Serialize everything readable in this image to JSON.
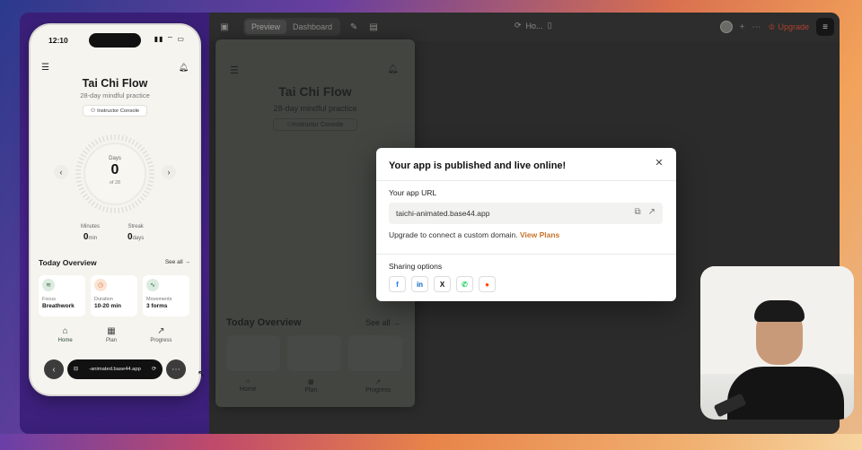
{
  "toolbar": {
    "preview_tab": "Preview",
    "dashboard_tab": "Dashboard",
    "center_label": "Ho...",
    "upgrade_label": "Upgrade"
  },
  "phone": {
    "time": "12:10",
    "app_title": "Tai Chi Flow",
    "app_subtitle": "28-day mindful practice",
    "instructor_console": "Instructor Console",
    "days_label": "Days",
    "days_value": "0",
    "days_of": "of 28",
    "stats": [
      {
        "label": "Minutes",
        "value": "0",
        "unit": "min"
      },
      {
        "label": "Streak",
        "value": "0",
        "unit": "days"
      }
    ],
    "today_overview": "Today Overview",
    "see_all": "See all →",
    "tiles": [
      {
        "label": "Focus",
        "value": "Breathwork",
        "color": "#dcebe0",
        "icon": "wind-icon"
      },
      {
        "label": "Duration",
        "value": "10-20 min",
        "color": "#fbe3d2",
        "icon": "clock-icon"
      },
      {
        "label": "Movements",
        "value": "3 forms",
        "color": "#dcebe0",
        "icon": "pulse-icon"
      }
    ],
    "nav": [
      {
        "label": "Home",
        "icon": "home-icon"
      },
      {
        "label": "Plan",
        "icon": "calendar-icon"
      },
      {
        "label": "Progress",
        "icon": "trend-icon"
      }
    ],
    "url_bar": "-animated.base44.app"
  },
  "preview": {
    "app_title": "Tai Chi Flow",
    "app_subtitle": "28-day mindful practice",
    "instructor_console": "Instructor Console",
    "today_overview": "Today Overview",
    "see_all": "See all →",
    "nav": [
      "Home",
      "Plan",
      "Progress"
    ]
  },
  "modal": {
    "title": "Your app is published and live online!",
    "url_label": "Your app URL",
    "url_value": "taichi-animated.base44.app",
    "upgrade_text": "Upgrade to connect a custom domain.",
    "upgrade_link": "View Plans",
    "sharing_label": "Sharing options",
    "share_buttons": [
      {
        "name": "facebook",
        "glyph": "f",
        "color": "#1877f2"
      },
      {
        "name": "linkedin",
        "glyph": "in",
        "color": "#0a66c2"
      },
      {
        "name": "x",
        "glyph": "X",
        "color": "#111111"
      },
      {
        "name": "whatsapp",
        "glyph": "✆",
        "color": "#25d366"
      },
      {
        "name": "reddit",
        "glyph": "●",
        "color": "#ff4500"
      }
    ]
  },
  "colors": {
    "accent": "#c9722a",
    "brand_green": "#2c4a36"
  }
}
